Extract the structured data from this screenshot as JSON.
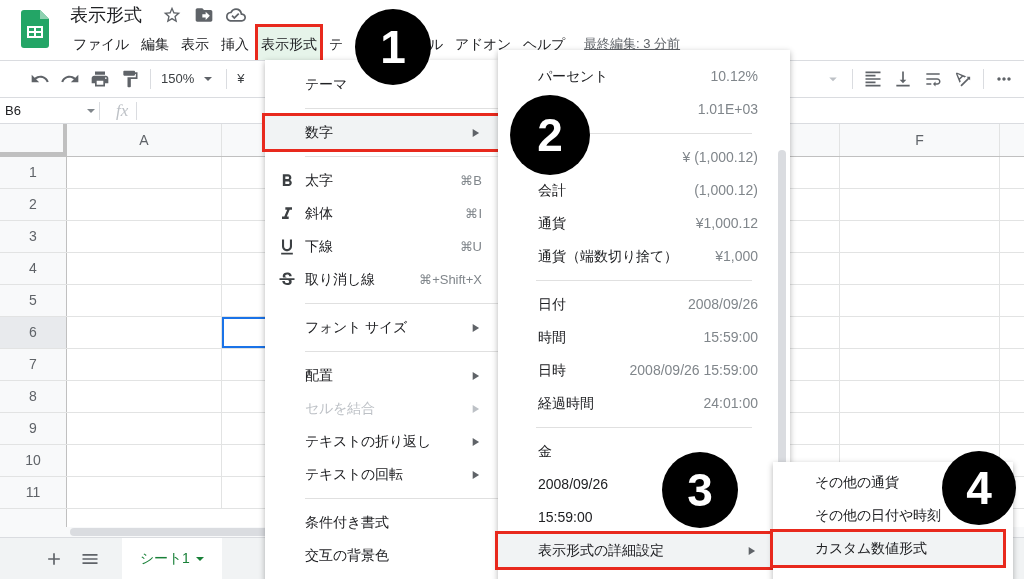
{
  "document": {
    "title": "表示形式"
  },
  "menubar": {
    "items": [
      {
        "label": "ファイル",
        "selected": false
      },
      {
        "label": "編集",
        "selected": false
      },
      {
        "label": "表示",
        "selected": false
      },
      {
        "label": "挿入",
        "selected": false
      },
      {
        "label": "表示形式",
        "selected": true
      },
      {
        "label": "テ",
        "selected": false
      }
    ],
    "items_after_callout": [
      {
        "label": "ル",
        "selected": false
      },
      {
        "label": "アドオン",
        "selected": false
      },
      {
        "label": "ヘルプ",
        "selected": false
      }
    ],
    "last_edit": "最終編集: 3 分前"
  },
  "toolbar": {
    "zoom": "150%",
    "currency": "¥"
  },
  "formula_bar": {
    "cell_ref": "B6",
    "fx": "fx"
  },
  "grid": {
    "columns": [
      "A",
      "F"
    ],
    "rows": [
      {
        "label": "1",
        "selected": false
      },
      {
        "label": "2",
        "selected": false
      },
      {
        "label": "3",
        "selected": false
      },
      {
        "label": "4",
        "selected": false
      },
      {
        "label": "5",
        "selected": false
      },
      {
        "label": "6",
        "selected": true
      },
      {
        "label": "7",
        "selected": false
      },
      {
        "label": "8",
        "selected": false
      },
      {
        "label": "9",
        "selected": false
      },
      {
        "label": "10",
        "selected": false
      },
      {
        "label": "11",
        "selected": false
      }
    ]
  },
  "sheet_tabs": [
    {
      "label": "シート1",
      "selected": true
    }
  ],
  "format_menu": [
    [
      {
        "label": "テーマ",
        "kind": "plain",
        "submenu": false,
        "disabled": false,
        "selected": false
      }
    ],
    [
      {
        "label": "数字",
        "kind": "plain",
        "submenu": true,
        "disabled": false,
        "selected": true
      }
    ],
    [
      {
        "label": "太字",
        "kind": "bold",
        "shortcut": "⌘B",
        "submenu": false,
        "disabled": false,
        "selected": false
      },
      {
        "label": "斜体",
        "kind": "italic",
        "shortcut": "⌘I",
        "submenu": false,
        "disabled": false,
        "selected": false
      },
      {
        "label": "下線",
        "kind": "underline",
        "shortcut": "⌘U",
        "submenu": false,
        "disabled": false,
        "selected": false
      },
      {
        "label": "取り消し線",
        "kind": "strikethrough",
        "shortcut": "⌘+Shift+X",
        "submenu": false,
        "disabled": false,
        "selected": false
      }
    ],
    [
      {
        "label": "フォント サイズ",
        "kind": "plain",
        "submenu": true,
        "disabled": false,
        "selected": false
      }
    ],
    [
      {
        "label": "配置",
        "kind": "plain",
        "submenu": true,
        "disabled": false,
        "selected": false
      },
      {
        "label": "セルを結合",
        "kind": "plain",
        "submenu": true,
        "disabled": true,
        "selected": false
      },
      {
        "label": "テキストの折り返し",
        "kind": "plain",
        "submenu": true,
        "disabled": false,
        "selected": false
      },
      {
        "label": "テキストの回転",
        "kind": "plain",
        "submenu": true,
        "disabled": false,
        "selected": false
      }
    ],
    [
      {
        "label": "条件付き書式",
        "kind": "plain",
        "submenu": false,
        "disabled": false,
        "selected": false
      },
      {
        "label": "交互の背景色",
        "kind": "plain",
        "submenu": false,
        "disabled": false,
        "selected": false
      }
    ]
  ],
  "number_menu": [
    [
      {
        "label": "パーセント",
        "value": "10.12%",
        "submenu": false,
        "selected": false
      },
      {
        "value": "1.01E+03",
        "submenu": false,
        "selected": false
      }
    ],
    [
      {
        "value": "¥ (1,000.12)",
        "submenu": false,
        "selected": false
      },
      {
        "label": "会計",
        "value": "(1,000.12)",
        "submenu": false,
        "selected": false
      },
      {
        "label": "通貨",
        "value": "¥1,000.12",
        "submenu": false,
        "selected": false
      },
      {
        "label": "通貨（端数切り捨て）",
        "value": "¥1,000",
        "submenu": false,
        "selected": false
      }
    ],
    [
      {
        "label": "日付",
        "value": "2008/09/26",
        "submenu": false,
        "selected": false
      },
      {
        "label": "時間",
        "value": "15:59:00",
        "submenu": false,
        "selected": false
      },
      {
        "label": "日時",
        "value": "2008/09/26 15:59:00",
        "submenu": false,
        "selected": false
      },
      {
        "label": "経過時間",
        "value": "24:01:00",
        "submenu": false,
        "selected": false
      }
    ],
    [
      {
        "label": "金",
        "submenu": false,
        "selected": false
      },
      {
        "label": "2008/09/26",
        "submenu": false,
        "selected": false
      },
      {
        "label": "15:59:00",
        "submenu": false,
        "selected": false
      },
      {
        "label": "表示形式の詳細設定",
        "submenu": true,
        "selected": true
      }
    ]
  ],
  "more_formats_menu": [
    {
      "label": "その他の通貨",
      "selected": false
    },
    {
      "label": "その他の日付や時刻",
      "selected": false
    },
    {
      "label": "カスタム数値形式",
      "selected": true
    }
  ],
  "callouts": [
    {
      "number": "1"
    },
    {
      "number": "2"
    },
    {
      "number": "3"
    },
    {
      "number": "4"
    }
  ]
}
